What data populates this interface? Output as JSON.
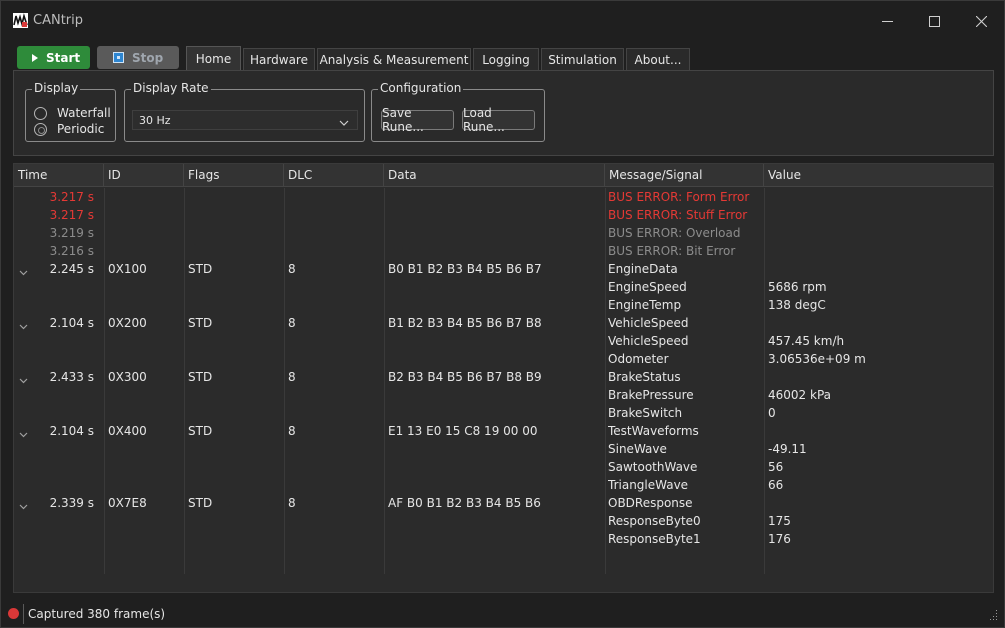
{
  "window": {
    "title": "CANtrip"
  },
  "colors": {
    "accent_green": "#2e8b3a",
    "error_red": "#e53935",
    "dim_gray": "#8c8c8c",
    "status_dot": "#d93838"
  },
  "toolbar": {
    "start_label": "Start",
    "stop_label": "Stop"
  },
  "tabs": [
    "Home",
    "Hardware",
    "Analysis & Measurement",
    "Logging",
    "Stimulation",
    "About..."
  ],
  "active_tab": "Home",
  "home": {
    "display": {
      "title": "Display",
      "options": [
        "Waterfall",
        "Periodic"
      ],
      "selected": "Periodic"
    },
    "rate": {
      "title": "Display Rate",
      "value": "30 Hz"
    },
    "config": {
      "title": "Configuration",
      "save_label": "Save Rune...",
      "load_label": "Load Rune..."
    }
  },
  "table": {
    "headers": [
      "Time",
      "ID",
      "Flags",
      "DLC",
      "Data",
      "Message/Signal",
      "Value"
    ],
    "rows": [
      {
        "time": "3.217 s",
        "id": "",
        "flags": "",
        "dlc": "",
        "data": "",
        "msg": "BUS ERROR: Form Error",
        "value": "",
        "style": "error",
        "expander": false
      },
      {
        "time": "3.217 s",
        "id": "",
        "flags": "",
        "dlc": "",
        "data": "",
        "msg": "BUS ERROR: Stuff Error",
        "value": "",
        "style": "error",
        "expander": false
      },
      {
        "time": "3.219 s",
        "id": "",
        "flags": "",
        "dlc": "",
        "data": "",
        "msg": "BUS ERROR: Overload",
        "value": "",
        "style": "dim",
        "expander": false
      },
      {
        "time": "3.216 s",
        "id": "",
        "flags": "",
        "dlc": "",
        "data": "",
        "msg": "BUS ERROR: Bit Error",
        "value": "",
        "style": "dim",
        "expander": false
      },
      {
        "time": "2.245 s",
        "id": "0X100",
        "flags": "STD",
        "dlc": "8",
        "data": "B0 B1 B2 B3 B4 B5 B6 B7",
        "msg": "EngineData",
        "value": "",
        "style": "normal",
        "expander": true
      },
      {
        "time": "",
        "id": "",
        "flags": "",
        "dlc": "",
        "data": "",
        "msg": "EngineSpeed",
        "value": "5686 rpm",
        "style": "normal",
        "expander": false
      },
      {
        "time": "",
        "id": "",
        "flags": "",
        "dlc": "",
        "data": "",
        "msg": "EngineTemp",
        "value": "138 degC",
        "style": "normal",
        "expander": false
      },
      {
        "time": "2.104 s",
        "id": "0X200",
        "flags": "STD",
        "dlc": "8",
        "data": "B1 B2 B3 B4 B5 B6 B7 B8",
        "msg": "VehicleSpeed",
        "value": "",
        "style": "normal",
        "expander": true
      },
      {
        "time": "",
        "id": "",
        "flags": "",
        "dlc": "",
        "data": "",
        "msg": "VehicleSpeed",
        "value": "457.45 km/h",
        "style": "normal",
        "expander": false
      },
      {
        "time": "",
        "id": "",
        "flags": "",
        "dlc": "",
        "data": "",
        "msg": "Odometer",
        "value": "3.06536e+09 m",
        "style": "normal",
        "expander": false
      },
      {
        "time": "2.433 s",
        "id": "0X300",
        "flags": "STD",
        "dlc": "8",
        "data": "B2 B3 B4 B5 B6 B7 B8 B9",
        "msg": "BrakeStatus",
        "value": "",
        "style": "normal",
        "expander": true
      },
      {
        "time": "",
        "id": "",
        "flags": "",
        "dlc": "",
        "data": "",
        "msg": "BrakePressure",
        "value": "46002 kPa",
        "style": "normal",
        "expander": false
      },
      {
        "time": "",
        "id": "",
        "flags": "",
        "dlc": "",
        "data": "",
        "msg": "BrakeSwitch",
        "value": "0",
        "style": "normal",
        "expander": false
      },
      {
        "time": "2.104 s",
        "id": "0X400",
        "flags": "STD",
        "dlc": "8",
        "data": "E1 13 E0 15 C8 19 00 00",
        "msg": "TestWaveforms",
        "value": "",
        "style": "normal",
        "expander": true
      },
      {
        "time": "",
        "id": "",
        "flags": "",
        "dlc": "",
        "data": "",
        "msg": "SineWave",
        "value": "-49.11",
        "style": "normal",
        "expander": false
      },
      {
        "time": "",
        "id": "",
        "flags": "",
        "dlc": "",
        "data": "",
        "msg": "SawtoothWave",
        "value": "56",
        "style": "normal",
        "expander": false
      },
      {
        "time": "",
        "id": "",
        "flags": "",
        "dlc": "",
        "data": "",
        "msg": "TriangleWave",
        "value": "66",
        "style": "normal",
        "expander": false
      },
      {
        "time": "2.339 s",
        "id": "0X7E8",
        "flags": "STD",
        "dlc": "8",
        "data": "AF B0 B1 B2 B3 B4 B5 B6",
        "msg": "OBDResponse",
        "value": "",
        "style": "normal",
        "expander": true
      },
      {
        "time": "",
        "id": "",
        "flags": "",
        "dlc": "",
        "data": "",
        "msg": "ResponseByte0",
        "value": "175",
        "style": "normal",
        "expander": false
      },
      {
        "time": "",
        "id": "",
        "flags": "",
        "dlc": "",
        "data": "",
        "msg": "ResponseByte1",
        "value": "176",
        "style": "normal",
        "expander": false
      }
    ]
  },
  "status": {
    "text": "Captured 380 frame(s)"
  }
}
